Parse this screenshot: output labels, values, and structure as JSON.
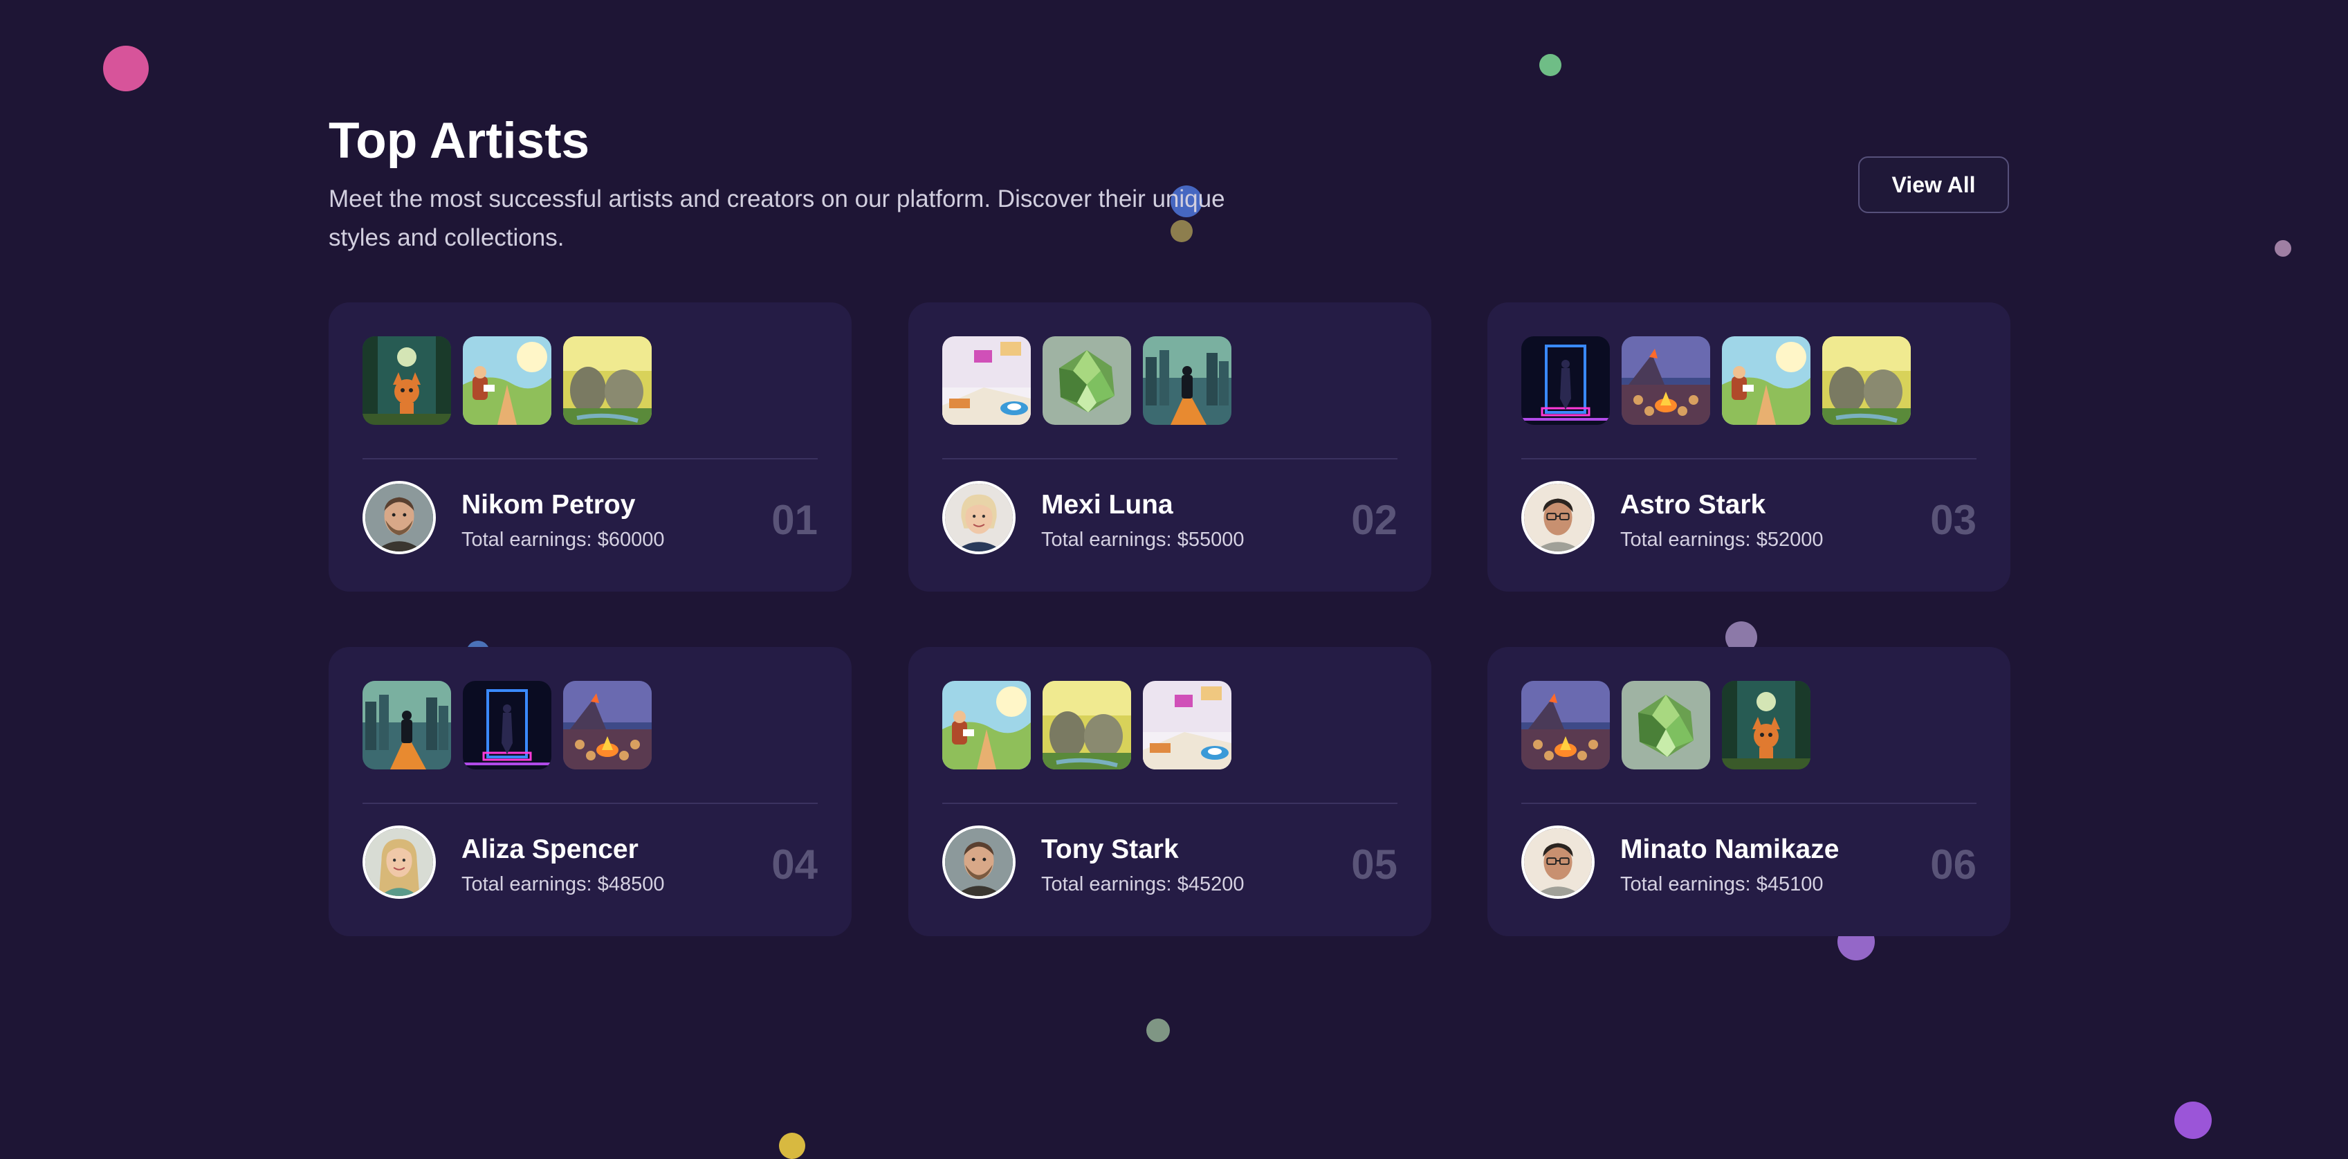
{
  "header": {
    "title": "Top Artists",
    "subtitle": "Meet the most successful artists and creators on our platform. Discover their unique styles and collections.",
    "view_all_label": "View All"
  },
  "earnings_label": "Total earnings:",
  "artists": [
    {
      "rank": "01",
      "name": "Nikom Petroy",
      "earnings": "$60000",
      "avatar": "man-beard",
      "artworks": [
        "fox-forest",
        "boy-reading",
        "moss-stones"
      ]
    },
    {
      "rank": "02",
      "name": "Mexi Luna",
      "earnings": "$55000",
      "avatar": "woman-blonde-short",
      "artworks": [
        "pastel-blocks",
        "green-crystal",
        "man-city-road"
      ]
    },
    {
      "rank": "03",
      "name": "Astro Stark",
      "earnings": "$52000",
      "avatar": "man-glasses",
      "artworks": [
        "neon-portal",
        "volcano-campfire",
        "boy-reading",
        "moss-stones"
      ]
    },
    {
      "rank": "04",
      "name": "Aliza Spencer",
      "earnings": "$48500",
      "avatar": "woman-blonde-long",
      "artworks": [
        "man-city-road",
        "neon-portal",
        "volcano-campfire"
      ]
    },
    {
      "rank": "05",
      "name": "Tony Stark",
      "earnings": "$45200",
      "avatar": "man-beard",
      "artworks": [
        "boy-reading",
        "moss-stones",
        "pastel-blocks"
      ]
    },
    {
      "rank": "06",
      "name": "Minato Namikaze",
      "earnings": "$45100",
      "avatar": "man-glasses",
      "artworks": [
        "volcano-campfire",
        "green-crystal",
        "fox-forest"
      ]
    }
  ],
  "colors": {
    "background": "#1e1535",
    "card": "#251c45",
    "rank": "#5a5478",
    "divider": "#3b3260"
  }
}
